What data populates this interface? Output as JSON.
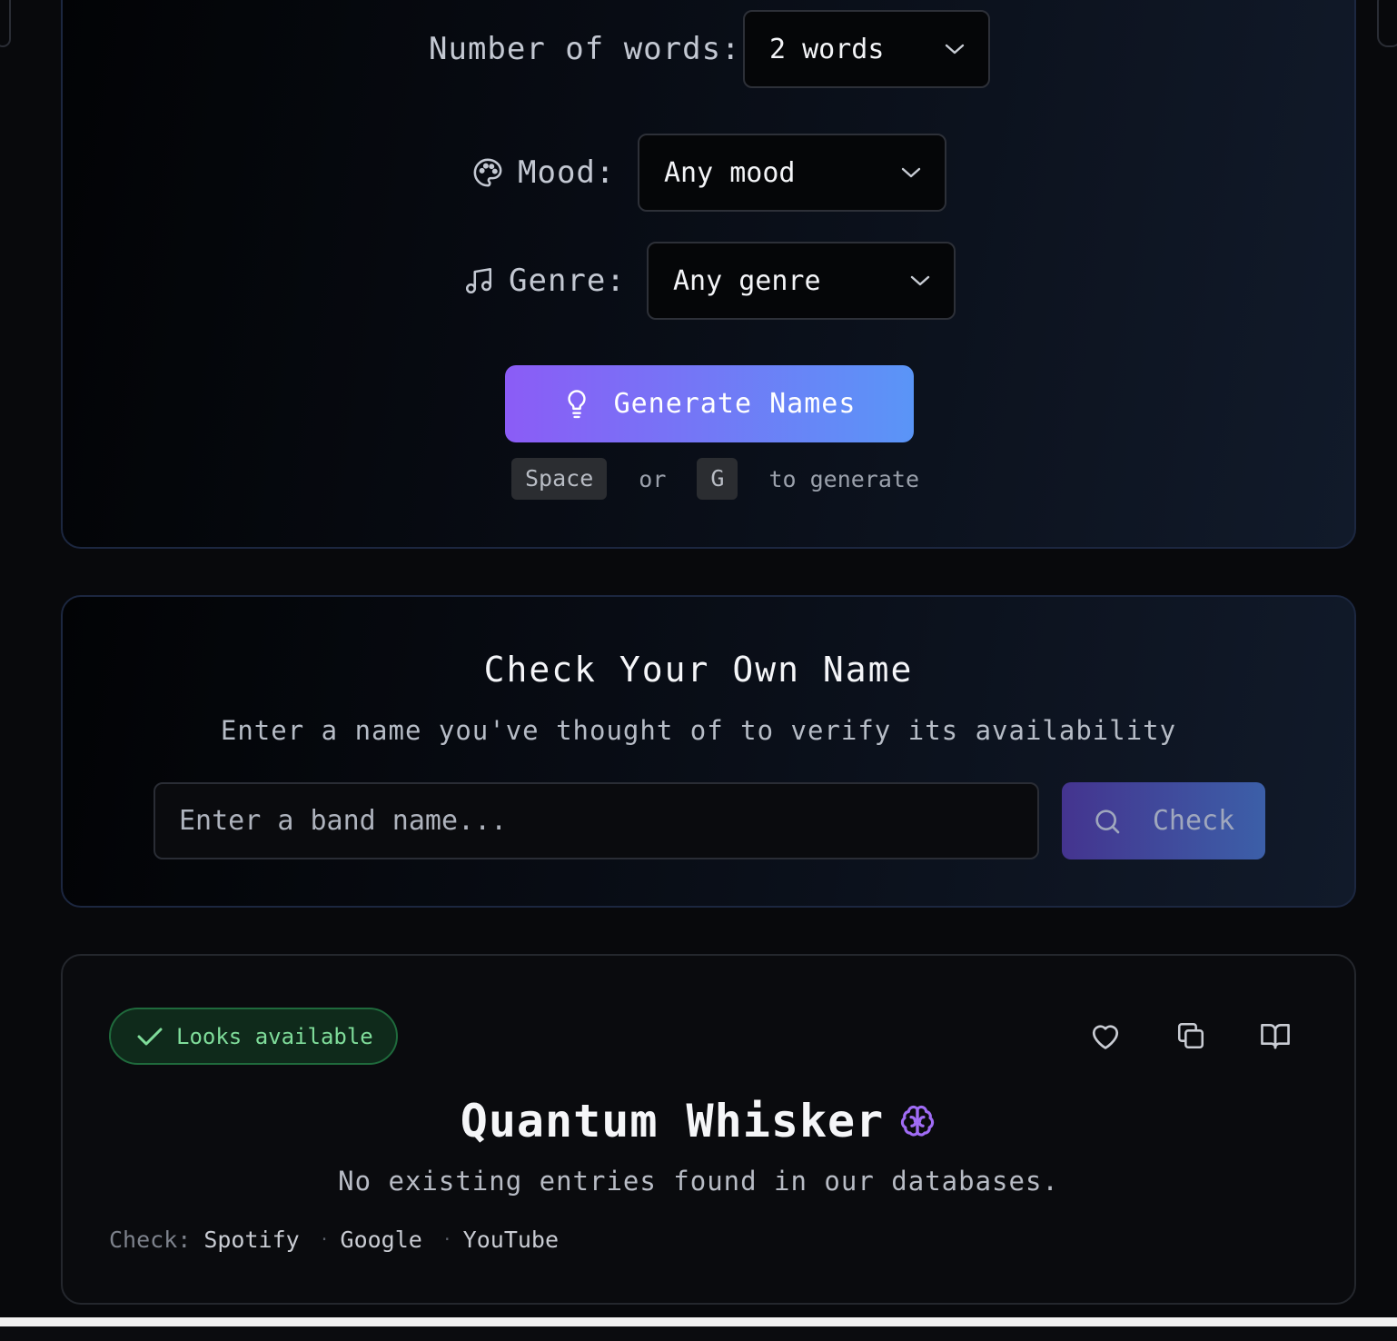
{
  "generator": {
    "words": {
      "label": "Number of words:",
      "value": "2 words"
    },
    "mood": {
      "label": "Mood:",
      "value": "Any mood",
      "icon": "palette-icon"
    },
    "genre": {
      "label": "Genre:",
      "value": "Any genre",
      "icon": "music-note-icon"
    },
    "generate_button": {
      "label": "Generate Names",
      "icon": "lightbulb-icon"
    },
    "hint": {
      "key1": "Space",
      "or": "or",
      "key2": "G",
      "suffix": "to generate"
    }
  },
  "check": {
    "title": "Check Your Own Name",
    "subtitle": "Enter a name you've thought of to verify its availability",
    "input_placeholder": "Enter a band name...",
    "button_label": "Check",
    "button_icon": "search-icon"
  },
  "result": {
    "status": "Looks available",
    "status_color": "#7fdc9a",
    "name": "Quantum Whisker",
    "name_icon": "brain-icon",
    "name_icon_color": "#a06cf5",
    "description": "No existing entries found in our databases.",
    "links_label": "Check:",
    "links": [
      "Spotify",
      "Google",
      "YouTube"
    ],
    "actions": [
      "heart-icon",
      "copy-icon",
      "book-icon"
    ]
  },
  "colors": {
    "accent_gradient_start": "#8b5cf6",
    "accent_gradient_end": "#5a95f7",
    "success": "#7fdc9a"
  }
}
